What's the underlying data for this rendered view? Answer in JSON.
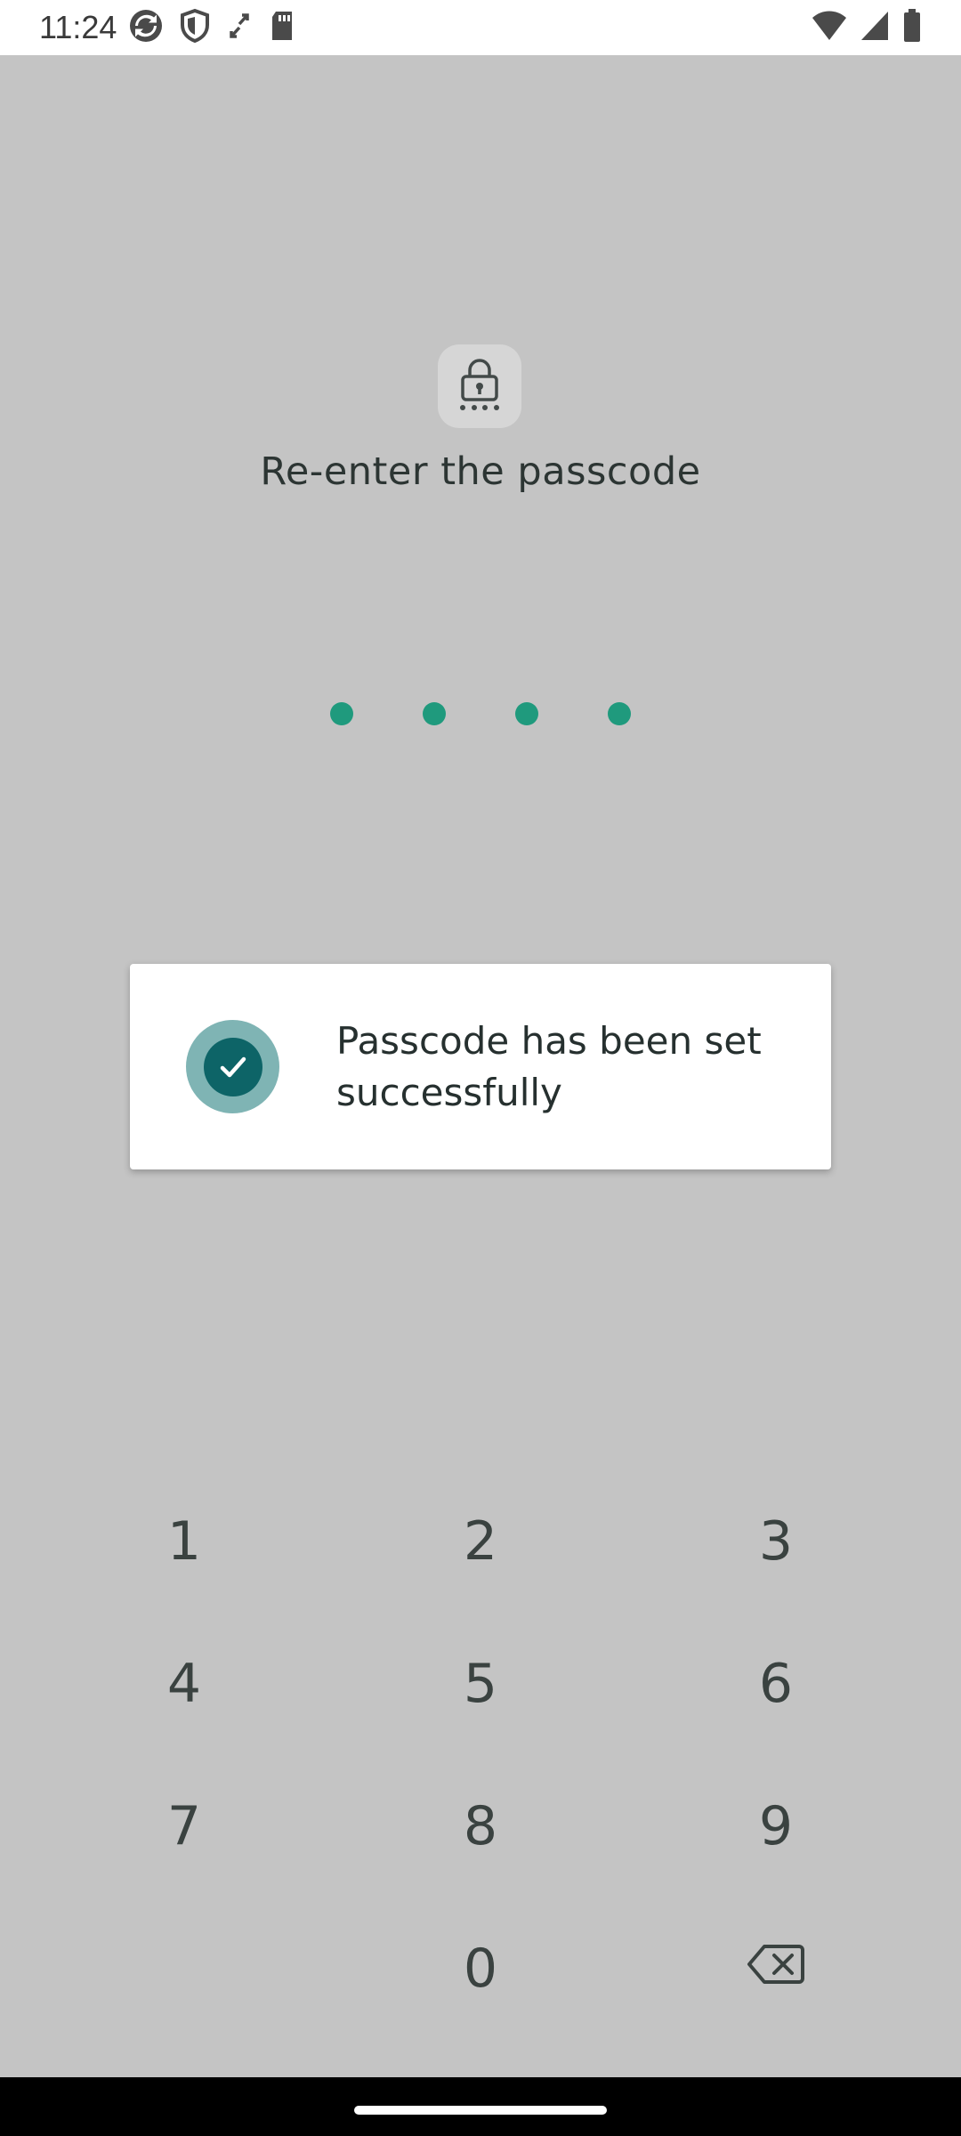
{
  "status_bar": {
    "time": "11:24",
    "left_icons": [
      "sync-icon",
      "shield-icon",
      "data-transfer-icon",
      "sd-card-icon"
    ],
    "right_icons": [
      "wifi-icon",
      "cell-signal-icon",
      "battery-icon"
    ]
  },
  "screen": {
    "lock_icon": "lock-icon",
    "title": "Re-enter the passcode",
    "dots_filled": 4,
    "dot_color": "#1f9a7d"
  },
  "keypad": {
    "keys": [
      "1",
      "2",
      "3",
      "4",
      "5",
      "6",
      "7",
      "8",
      "9",
      "0"
    ],
    "backspace_icon": "backspace-icon"
  },
  "toast": {
    "icon": "check-circle-icon",
    "message": "Passcode has been set successfully",
    "icon_outer_color": "#7fb4b4",
    "icon_inner_color": "#0d6467"
  }
}
